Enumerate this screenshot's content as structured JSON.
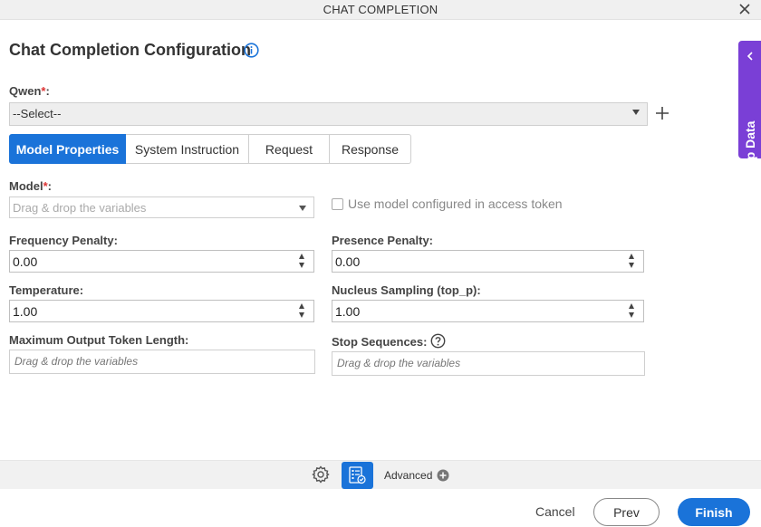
{
  "window": {
    "title": "CHAT COMPLETION",
    "close_icon": "close-icon"
  },
  "heading": "Chat Completion Configuration",
  "connection": {
    "label": "Qwen",
    "required_mark": "*",
    "colon": ":",
    "selected": "--Select--"
  },
  "tabs": [
    {
      "label": "Model Properties",
      "active": true
    },
    {
      "label": "System Instruction",
      "active": false
    },
    {
      "label": "Request",
      "active": false
    },
    {
      "label": "Response",
      "active": false
    }
  ],
  "model": {
    "label": "Model",
    "required_mark": "*",
    "colon": ":",
    "placeholder": "Drag & drop the variables",
    "checkbox_label": "Use model configured in access token",
    "checkbox_checked": false
  },
  "fields": {
    "frequency_penalty": {
      "label": "Frequency Penalty:",
      "value": "0.00"
    },
    "presence_penalty": {
      "label": "Presence Penalty:",
      "value": "0.00"
    },
    "temperature": {
      "label": "Temperature:",
      "value": "1.00"
    },
    "top_p": {
      "label": "Nucleus Sampling (top_p):",
      "value": "1.00"
    },
    "max_tokens": {
      "label": "Maximum Output Token Length:",
      "placeholder": "Drag & drop the variables"
    },
    "stop_sequences": {
      "label": "Stop Sequences:",
      "placeholder": "Drag & drop the variables"
    }
  },
  "side_panel": {
    "label": "App Data"
  },
  "toolbar": {
    "advanced_label": "Advanced"
  },
  "footer": {
    "cancel": "Cancel",
    "prev": "Prev",
    "finish": "Finish"
  },
  "colors": {
    "primary": "#1a73d9",
    "side_panel": "#7a3fd6",
    "required": "#dd3333"
  }
}
